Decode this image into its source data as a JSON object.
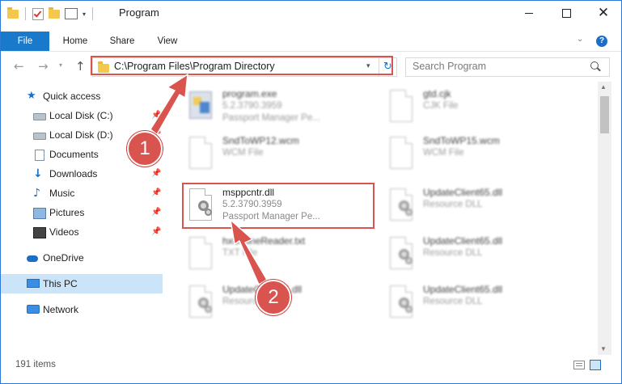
{
  "window": {
    "title": "Program",
    "controls": {
      "minimize": "minimize-icon",
      "maximize": "maximize-icon",
      "close": "close-icon"
    }
  },
  "ribbon": {
    "tabs": [
      "File",
      "Home",
      "Share",
      "View"
    ],
    "help_icon": "help-icon"
  },
  "address": {
    "path": "C:\\Program Files\\Program Directory"
  },
  "search": {
    "placeholder": "Search Program"
  },
  "sidebar": {
    "items": [
      {
        "label": "Quick access",
        "icon": "star-icon"
      },
      {
        "label": "Local Disk (C:)",
        "icon": "drive-icon",
        "pinned": true
      },
      {
        "label": "Local Disk (D:)",
        "icon": "drive-icon",
        "pinned": true
      },
      {
        "label": "Documents",
        "icon": "documents-icon",
        "pinned": true
      },
      {
        "label": "Downloads",
        "icon": "downloads-icon",
        "pinned": true
      },
      {
        "label": "Music",
        "icon": "music-icon",
        "pinned": true
      },
      {
        "label": "Pictures",
        "icon": "pictures-icon",
        "pinned": true
      },
      {
        "label": "Videos",
        "icon": "videos-icon",
        "pinned": true
      },
      {
        "label": "OneDrive",
        "icon": "onedrive-icon"
      },
      {
        "label": "This PC",
        "icon": "this-pc-icon",
        "selected": true
      },
      {
        "label": "Network",
        "icon": "network-icon"
      }
    ]
  },
  "files": [
    {
      "name": "program.exe",
      "meta1": "5.2.3790.3959",
      "meta2": "Passport Manager Pe...",
      "icon": "exe-icon"
    },
    {
      "name": "gtd.cjk",
      "meta1": "CJK File",
      "meta2": "",
      "icon": "file-icon"
    },
    {
      "name": "SndToWP12.wcm",
      "meta1": "WCM File",
      "meta2": "",
      "icon": "file-icon"
    },
    {
      "name": "SndToWP15.wcm",
      "meta1": "WCM File",
      "meta2": "",
      "icon": "file-icon"
    },
    {
      "name": "msppcntr.dll",
      "meta1": "5.2.3790.3959",
      "meta2": "Passport Manager Pe...",
      "icon": "dll-icon"
    },
    {
      "name": "UpdateClient65.dll",
      "meta1": "Resource DLL",
      "meta2": "",
      "icon": "dll-icon"
    },
    {
      "name": "hxOnlineReader.txt",
      "meta1": "TXT File",
      "meta2": "",
      "icon": "file-icon"
    },
    {
      "name": "UpdateClient65.dll",
      "meta1": "Resource DLL",
      "meta2": "",
      "icon": "dll-icon"
    },
    {
      "name": "UpdateClient65.dll",
      "meta1": "Resource DLL",
      "meta2": "",
      "icon": "dll-icon"
    },
    {
      "name": "UpdateClient65.dll",
      "meta1": "Resource DLL",
      "meta2": "",
      "icon": "dll-icon"
    }
  ],
  "annotations": {
    "step1": "1",
    "step2": "2",
    "color": "#d9534f"
  },
  "status": {
    "count": "191 items"
  }
}
